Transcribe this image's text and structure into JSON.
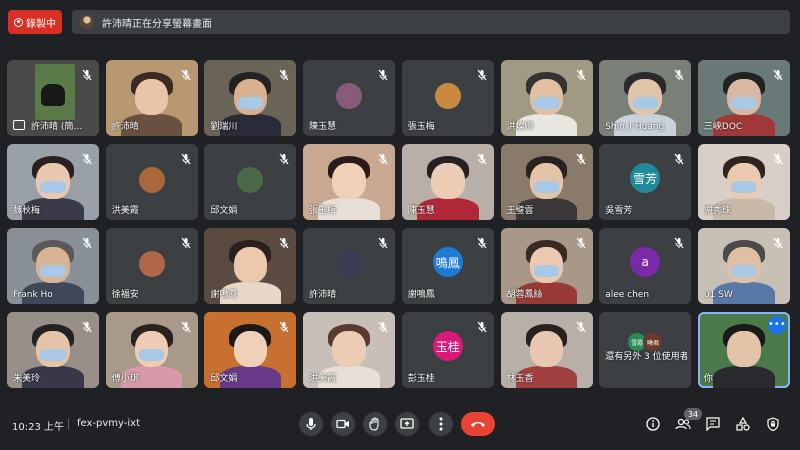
{
  "recording": {
    "label": "錄製中"
  },
  "banner": {
    "text": "許沛晴正在分享螢幕畫面"
  },
  "tiles": [
    {
      "name": "許沛晴 (簡…",
      "kind": "share",
      "bg": "#4a4a48"
    },
    {
      "name": "許沛晴",
      "kind": "video",
      "bg": "#b89870",
      "skin": "#e8c4a8",
      "hair": "#3a2a22",
      "shirt": "#6a5040",
      "mask": false
    },
    {
      "name": "劉瑞川",
      "kind": "video",
      "bg": "#6a6458",
      "skin": "#d8b090",
      "hair": "#222222",
      "shirt": "#2a2a38",
      "mask": true
    },
    {
      "name": "陳玉慧",
      "kind": "avatar",
      "color": "#8a5a7a",
      "avatar_text": ""
    },
    {
      "name": "張玉梅",
      "kind": "avatar",
      "color": "#c88a40",
      "avatar_text": ""
    },
    {
      "name": "洪燦卿",
      "kind": "video",
      "bg": "#a09a84",
      "skin": "#e0c0a0",
      "hair": "#333333",
      "shirt": "#e8e8e0",
      "mask": true
    },
    {
      "name": "Shin_I Huang",
      "kind": "video",
      "bg": "#7a8078",
      "skin": "#e0c4a8",
      "hair": "#2a2a2a",
      "shirt": "#c8d0d8",
      "mask": true
    },
    {
      "name": "三峽DOC",
      "kind": "video",
      "bg": "#6a7a78",
      "skin": "#d8b8a0",
      "hair": "#222222",
      "shirt": "#a03838",
      "mask": true
    },
    {
      "name": "魏秋梅",
      "kind": "video",
      "bg": "#9aa0a8",
      "skin": "#e8c8b0",
      "hair": "#2a2020",
      "shirt": "#3a3a48",
      "mask": true
    },
    {
      "name": "洪美霞",
      "kind": "avatar",
      "color": "#a8683a",
      "avatar_text": ""
    },
    {
      "name": "邱文娟",
      "kind": "avatar",
      "color": "#4a6a4a",
      "avatar_text": ""
    },
    {
      "name": "張玉梅",
      "kind": "video",
      "bg": "#c8a890",
      "skin": "#f0d0b8",
      "hair": "#2a1a18",
      "shirt": "#e8e0d8",
      "mask": false
    },
    {
      "name": "陳玉慧",
      "kind": "video",
      "bg": "#b8b0a8",
      "skin": "#ecccb4",
      "hair": "#222222",
      "shirt": "#b02838",
      "mask": false
    },
    {
      "name": "王璧雲",
      "kind": "video",
      "bg": "#8a7a6a",
      "skin": "#e4c4a8",
      "hair": "#2a2220",
      "shirt": "#3a3838",
      "mask": true
    },
    {
      "name": "吳雪芳",
      "kind": "avatar",
      "color": "#1e8a9a",
      "avatar_text": "雪芳"
    },
    {
      "name": "謝秀珠",
      "kind": "video",
      "bg": "#d8d0c8",
      "skin": "#eccab0",
      "hair": "#302420",
      "shirt": "#c8b8a8",
      "mask": true
    },
    {
      "name": "Frank Ho",
      "kind": "video",
      "bg": "#8a9098",
      "skin": "#d8b494",
      "hair": "#5a5a5a",
      "shirt": "#404858",
      "mask": true
    },
    {
      "name": "徐福安",
      "kind": "avatar",
      "color": "#b06848",
      "avatar_text": ""
    },
    {
      "name": "謝鳴鳳",
      "kind": "video",
      "bg": "#5a4a40",
      "skin": "#ecc8ac",
      "hair": "#2a2020",
      "shirt": "#e8d8c8",
      "mask": false
    },
    {
      "name": "許沛晴",
      "kind": "avatar",
      "color": "#3a3a52",
      "avatar_text": ""
    },
    {
      "name": "謝鳴鳳",
      "kind": "avatar",
      "color": "#1e7ad2",
      "avatar_text": "鳴鳳"
    },
    {
      "name": "胡蓉鳳絲",
      "kind": "video",
      "bg": "#a8988a",
      "skin": "#ecc8b0",
      "hair": "#3a2a24",
      "shirt": "#9a3a38",
      "mask": true
    },
    {
      "name": "alee chen",
      "kind": "avatar",
      "color": "#7a2aa8",
      "avatar_text": "a"
    },
    {
      "name": "01 SW",
      "kind": "video",
      "bg": "#c8c0b4",
      "skin": "#e0c0a4",
      "hair": "#4a4a4a",
      "shirt": "#5878a8",
      "mask": true
    },
    {
      "name": "朱美玲",
      "kind": "video",
      "bg": "#989088",
      "skin": "#e4c4a8",
      "hair": "#222222",
      "shirt": "#383848",
      "mask": true
    },
    {
      "name": "傅小琪",
      "kind": "video",
      "bg": "#a89a88",
      "skin": "#ecccb4",
      "hair": "#2a2220",
      "shirt": "#d89aa8",
      "mask": true
    },
    {
      "name": "邱文娟",
      "kind": "video",
      "bg": "#c87030",
      "skin": "#f0d0b8",
      "hair": "#1a1818",
      "shirt": "#6a3a8a",
      "mask": false
    },
    {
      "name": "洪美霞",
      "kind": "video",
      "bg": "#c8c0b8",
      "skin": "#ecccb4",
      "hair": "#5a3a30",
      "shirt": "#e8e0d8",
      "mask": false
    },
    {
      "name": "彭玉桂",
      "kind": "avatar",
      "color": "#d81b78",
      "avatar_text": "玉桂"
    },
    {
      "name": "林玉香",
      "kind": "video",
      "bg": "#b8b0a8",
      "skin": "#e8c8b0",
      "hair": "#2a2020",
      "shirt": "#a04040",
      "mask": false
    },
    {
      "name": "還有另外 3 位使用者",
      "kind": "others",
      "minis": [
        {
          "t": "雪霞",
          "c": "#2a8a5a"
        },
        {
          "t": "曉君",
          "c": "#6a3a2a"
        }
      ]
    },
    {
      "name": "你",
      "kind": "self",
      "bg": "#4a7a4a",
      "skin": "#e4c4a8",
      "hair": "#1a1a1a",
      "shirt": "#2a2a30",
      "mask": false,
      "active": true
    }
  ],
  "meeting": {
    "time": "10:23 上午",
    "code": "fex-pvmy-ixt"
  },
  "participants_count": "34",
  "colors": {
    "accent": "#8ab4f8",
    "hangup": "#ea4335",
    "record": "#d93025"
  }
}
